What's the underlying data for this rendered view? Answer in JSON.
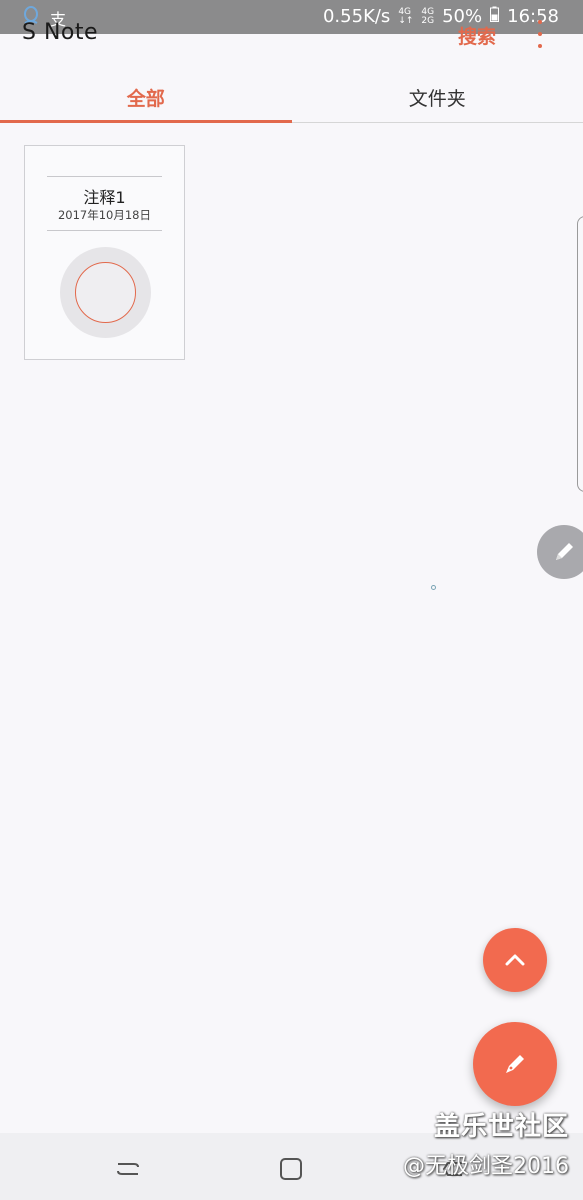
{
  "status_bar": {
    "left_icons": [
      "qq-icon",
      "alipay-icon"
    ],
    "left_text": "支",
    "network_speed": "0.55K/s",
    "signal1_label_top": "4G",
    "signal1_label_bottom": "↓↑",
    "signal2_label_top": "4G",
    "signal2_label_bottom": "2G",
    "battery": "50%",
    "time": "16:58"
  },
  "header": {
    "title": "S Note",
    "search_label": "搜索"
  },
  "tabs": [
    {
      "label": "全部",
      "active": true
    },
    {
      "label": "文件夹",
      "active": false
    }
  ],
  "notes": [
    {
      "title": "注释1",
      "date": "2017年10月18日"
    }
  ],
  "watermark": {
    "line1": "盖乐世社区",
    "line2": "@无极剑圣2016"
  },
  "colors": {
    "accent": "#e2694c",
    "fab": "#f26a4f",
    "background": "#f8f7fa"
  }
}
